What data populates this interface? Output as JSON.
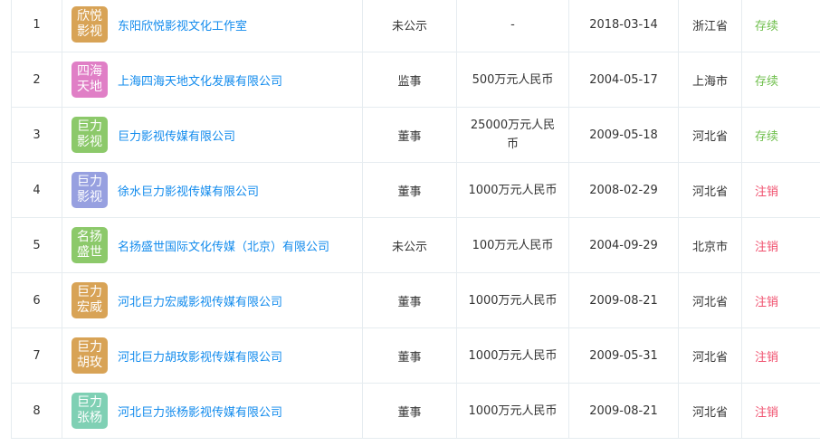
{
  "rows": [
    {
      "idx": "1",
      "logo_text": "欣悦影视",
      "logo_color": "#d8a356",
      "company": "东阳欣悦影视文化工作室",
      "role": "未公示",
      "capital": "-",
      "date": "2018-03-14",
      "province": "浙江省",
      "status": "存续",
      "status_type": "active"
    },
    {
      "idx": "2",
      "logo_text": "四海天地",
      "logo_color": "#e07fc6",
      "company": "上海四海天地文化发展有限公司",
      "role": "监事",
      "capital": "500万元人民币",
      "date": "2004-05-17",
      "province": "上海市",
      "status": "存续",
      "status_type": "active"
    },
    {
      "idx": "3",
      "logo_text": "巨力影视",
      "logo_color": "#8cc96a",
      "company": "巨力影视传媒有限公司",
      "role": "董事",
      "capital": "25000万元人民币",
      "date": "2009-05-18",
      "province": "河北省",
      "status": "存续",
      "status_type": "active"
    },
    {
      "idx": "4",
      "logo_text": "巨力影视",
      "logo_color": "#97a0e0",
      "company": "徐水巨力影视传媒有限公司",
      "role": "董事",
      "capital": "1000万元人民币",
      "date": "2008-02-29",
      "province": "河北省",
      "status": "注销",
      "status_type": "cancel"
    },
    {
      "idx": "5",
      "logo_text": "名扬盛世",
      "logo_color": "#8cc96a",
      "company": "名扬盛世国际文化传媒（北京）有限公司",
      "role": "未公示",
      "capital": "100万元人民币",
      "date": "2004-09-29",
      "province": "北京市",
      "status": "注销",
      "status_type": "cancel"
    },
    {
      "idx": "6",
      "logo_text": "巨力宏威",
      "logo_color": "#d8a356",
      "company": "河北巨力宏威影视传媒有限公司",
      "role": "董事",
      "capital": "1000万元人民币",
      "date": "2009-08-21",
      "province": "河北省",
      "status": "注销",
      "status_type": "cancel"
    },
    {
      "idx": "7",
      "logo_text": "巨力胡玫",
      "logo_color": "#d8a356",
      "company": "河北巨力胡玫影视传媒有限公司",
      "role": "董事",
      "capital": "1000万元人民币",
      "date": "2009-05-31",
      "province": "河北省",
      "status": "注销",
      "status_type": "cancel"
    },
    {
      "idx": "8",
      "logo_text": "巨力张杨",
      "logo_color": "#7fd0b4",
      "company": "河北巨力张杨影视传媒有限公司",
      "role": "董事",
      "capital": "1000万元人民币",
      "date": "2009-08-21",
      "province": "河北省",
      "status": "注销",
      "status_type": "cancel"
    }
  ],
  "colors": {
    "link": "#128bed",
    "status_active": "#6fbf4c",
    "status_cancel": "#f0506e",
    "border": "#e6ecf0"
  }
}
